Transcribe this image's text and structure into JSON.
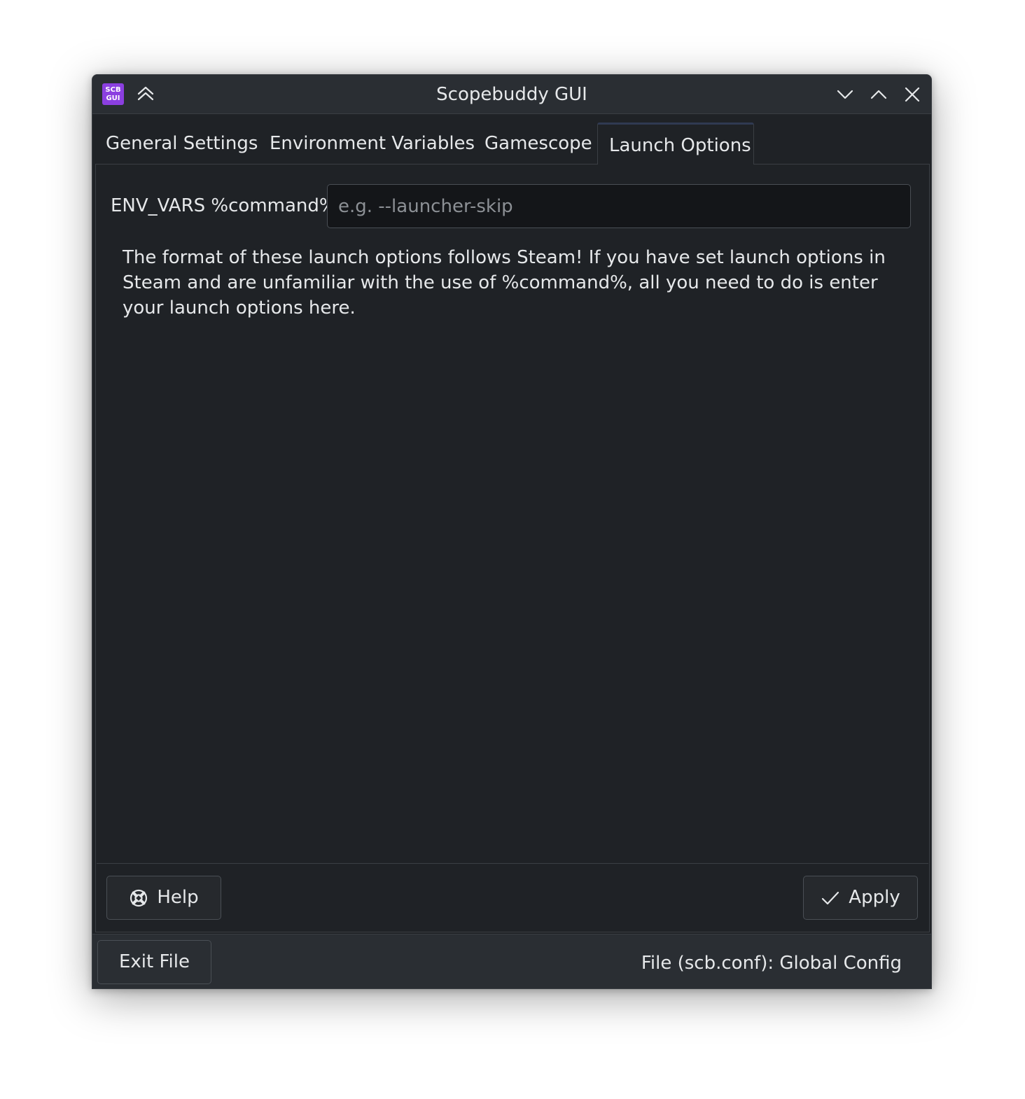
{
  "window": {
    "title": "Scopebuddy GUI",
    "app_icon_line1": "SCB",
    "app_icon_line2": "GUI",
    "accent_color": "#8b3fe0"
  },
  "tabs": [
    {
      "label": "General Settings",
      "active": false
    },
    {
      "label": "Environment Variables",
      "active": false
    },
    {
      "label": "Gamescope",
      "active": false
    },
    {
      "label": "Launch Options",
      "active": true
    }
  ],
  "launch_options": {
    "field_label": "ENV_VARS %command%",
    "field_value": "",
    "field_placeholder": "e.g. --launcher-skip",
    "description": "The format of these launch options follows Steam! If you have set launch options in Steam and are unfamiliar with the use of %command%, all you need to do is enter your launch options here."
  },
  "buttons": {
    "help_label": "Help",
    "help_icon": "lifebuoy-icon",
    "apply_label": "Apply",
    "apply_icon": "checkmark-icon"
  },
  "statusbar": {
    "exit_label": "Exit File",
    "file_status": "File (scb.conf): Global Config"
  }
}
